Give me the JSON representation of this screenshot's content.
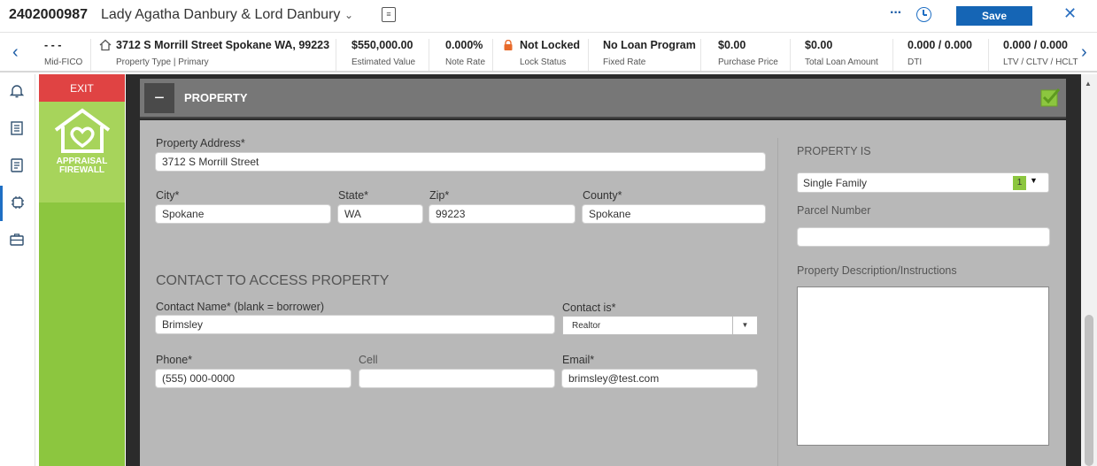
{
  "header": {
    "loan_number": "2402000987",
    "borrower_name": "Lady Agatha Danbury & Lord Danbury",
    "more_label": "···",
    "save_label": "Save"
  },
  "summary": {
    "fico": {
      "value": "- - -",
      "label": "Mid-FICO"
    },
    "property": {
      "value": "3712 S Morrill Street Spokane WA, 99223",
      "label": "Property Type | Primary"
    },
    "estimated_value": {
      "value": "$550,000.00",
      "label": "Estimated Value"
    },
    "note_rate": {
      "value": "0.000%",
      "label": "Note Rate"
    },
    "lock_status": {
      "value": "Not Locked",
      "label": "Lock Status"
    },
    "loan_program": {
      "value": "No Loan Program",
      "label": "Fixed Rate"
    },
    "purchase_price": {
      "value": "$0.00",
      "label": "Purchase Price"
    },
    "total_loan_amount": {
      "value": "$0.00",
      "label": "Total Loan Amount"
    },
    "dti": {
      "value": "0.000 / 0.000",
      "label": "DTI"
    },
    "ltv": {
      "value": "0.000 / 0.000",
      "label": "LTV / CLTV / HCLT"
    }
  },
  "side_panel": {
    "exit_label": "EXIT",
    "logo_line1": "APPRAISAL",
    "logo_line2": "FIREWALL"
  },
  "panel": {
    "title": "PROPERTY",
    "collapse_symbol": "−"
  },
  "form": {
    "property_address": {
      "label": "Property Address*",
      "value": "3712 S Morrill Street"
    },
    "city": {
      "label": "City*",
      "value": "Spokane"
    },
    "state": {
      "label": "State*",
      "value": "WA"
    },
    "zip": {
      "label": "Zip*",
      "value": "99223"
    },
    "county": {
      "label": "County*",
      "value": "Spokane"
    },
    "contact_section_title": "CONTACT TO ACCESS PROPERTY",
    "contact_name": {
      "label": "Contact Name* (blank = borrower)",
      "value": "Brimsley"
    },
    "contact_is": {
      "label": "Contact is*",
      "value": "Realtor"
    },
    "phone": {
      "label": "Phone*",
      "value": "(555) 000-0000"
    },
    "cell": {
      "label": "Cell",
      "value": ""
    },
    "email": {
      "label": "Email*",
      "value": "brimsley@test.com"
    }
  },
  "right_form": {
    "property_is": {
      "label": "PROPERTY IS",
      "value": "Single Family",
      "badge": "1"
    },
    "parcel_number": {
      "label": "Parcel Number",
      "value": ""
    },
    "description": {
      "label": "Property Description/Instructions",
      "value": ""
    }
  },
  "colors": {
    "accent_blue": "#1565b5",
    "exit_red": "#e04343",
    "brand_green": "#8cc63f"
  }
}
